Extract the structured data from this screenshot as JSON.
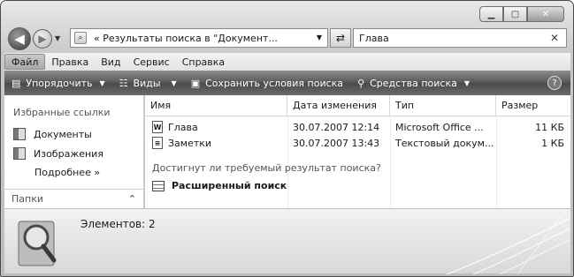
{
  "window": {
    "address": "« Результаты поиска в \"Документ...",
    "search_value": "Глава"
  },
  "menu": [
    "Файл",
    "Правка",
    "Вид",
    "Сервис",
    "Справка"
  ],
  "toolbar": {
    "organize": "Упорядочить",
    "views": "Виды",
    "save_search": "Сохранить условия поиска",
    "search_tools": "Средства поиска",
    "help": "?"
  },
  "left_pane": {
    "title": "Избранные ссылки",
    "items": [
      "Документы",
      "Изображения"
    ],
    "more": "Подробнее »",
    "folders": "Папки"
  },
  "columns": [
    "Имя",
    "Дата изменения",
    "Тип",
    "Размер"
  ],
  "files": [
    {
      "name": "Глава",
      "date": "30.07.2007 12:14",
      "type": "Microsoft Office ...",
      "size": "11 КБ",
      "icon": "word-doc-icon"
    },
    {
      "name": "Заметки",
      "date": "30.07.2007 13:43",
      "type": "Текстовый докум...",
      "size": "1 КБ",
      "icon": "text-doc-icon"
    }
  ],
  "search_prompt": "Достигнут ли требуемый результат поиска?",
  "advanced_search": "Расширенный поиск",
  "status": "Элементов: 2"
}
